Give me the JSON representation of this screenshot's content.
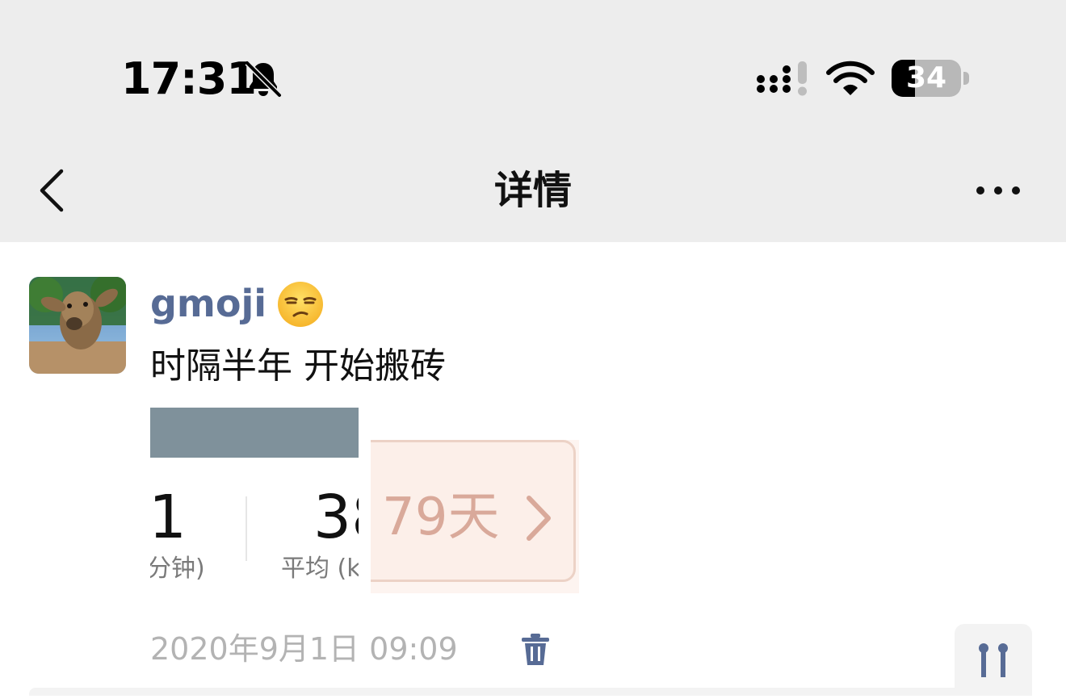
{
  "status_bar": {
    "time": "17:31",
    "battery_level": "34",
    "battery_fraction": 0.34,
    "icons": [
      "bell-off-icon",
      "cellular-signal-icon",
      "wifi-icon",
      "battery-icon"
    ]
  },
  "nav": {
    "title": "详情",
    "back_icon": "chevron-left-icon",
    "more_icon": "more-horizontal-icon"
  },
  "post": {
    "username": "gmoji",
    "emoji_icon": "unamused-face-emoji",
    "text": "时隔半年 开始搬砖",
    "timestamp": "2020年9月1日 09:09",
    "delete_icon": "trash-icon",
    "like_icon": "like-dots-icon",
    "images": [
      {
        "left_value": "1",
        "left_caption": "分钟)",
        "right_value": "38",
        "right_caption": "平均 (k"
      },
      {
        "text": "79天",
        "icon": "chevron-right-icon"
      }
    ]
  },
  "colors": {
    "header_bg": "#ededed",
    "username": "#576b95",
    "timestamp": "#b3b3b3",
    "trash": "#576b95"
  }
}
